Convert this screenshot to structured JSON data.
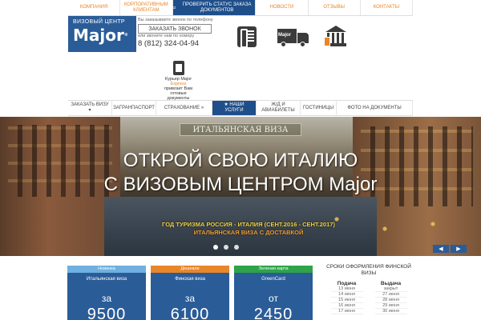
{
  "topnav": {
    "items": [
      {
        "label": "КОМПАНИЯ"
      },
      {
        "label": "КОРПОРАТИВНЫМ КЛИЕНТАМ"
      },
      {
        "label": "ПРОВЕРИТЬ СТАТУС ЗАКАЗА ДОКУМЕНТОВ",
        "active": true
      },
      {
        "label": "НОВОСТИ"
      },
      {
        "label": "ОТЗЫВЫ"
      },
      {
        "label": "КОНТАКТЫ"
      }
    ]
  },
  "header": {
    "logo_top": "ВИЗОВЫЙ ЦЕНТР",
    "logo_brand": "Major",
    "logo_mark": "®",
    "callback_note1": "Вы заказываете звонок по телефону",
    "callback_button": "ЗАКАЗАТЬ ЗВОНОК",
    "callback_note2": "или звоните нам по номеру",
    "phone": "8 (812) 324-04-94",
    "truck_text": "Major",
    "courier_line1": "Курьер Major",
    "courier_line2": "Express",
    "courier_line3": "привозит Вам готовые документы"
  },
  "subnav": {
    "items": [
      {
        "label": "ЗАКАЗАТЬ ВИЗУ ▾"
      },
      {
        "label": "ЗАГРАНПАСПОРТ"
      },
      {
        "label": "СТРАХОВАНИЕ »"
      },
      {
        "label": "★ НАШИ УСЛУГИ",
        "active": true
      },
      {
        "label": "Ж/Д И АВИАБИЛЕТЫ"
      },
      {
        "label": "ГОСТИНИЦЫ"
      },
      {
        "label": "ФОТО НА ДОКУМЕНТЫ"
      }
    ]
  },
  "hero": {
    "badge": "ИТАЛЬЯНСКАЯ ВИЗА",
    "heading_line1": "ОТКРОЙ СВОЮ ИТАЛИЮ",
    "heading_line2": "С ВИЗОВЫМ ЦЕНТРОМ Major",
    "sub_line1": "ГОД ТУРИЗМА РОССИЯ - ИТАЛИЯ (СЕНТ.2016 - СЕНТ.2017)",
    "sub_line2": "ИТАЛЬЯНСКАЯ ВИЗА С ДОСТАВКОЙ",
    "prev": "◀",
    "next": "▶"
  },
  "cards": [
    {
      "tag": "Новинка",
      "title": "Итальянская виза",
      "from": "за",
      "price": "9500",
      "tag_color": "#6fb0e0"
    },
    {
      "tag": "Дешевле",
      "title": "Финская виза",
      "from": "за",
      "price": "6100",
      "tag_color": "#e8862a"
    },
    {
      "tag": "Зеленая карта",
      "title": "GreenCard",
      "from": "от",
      "price": "2450",
      "tag_color": "#2ea34a"
    }
  ],
  "schedule": {
    "title": "СРОКИ ОФОРМЛЕНИЯ ФИНСКОЙ ВИЗЫ",
    "col1_header": "Подача",
    "col2_header": "Выдача",
    "col1": [
      "13 июня",
      "14 июня",
      "15 июня",
      "16 июня",
      "17 июня"
    ],
    "col2": [
      "закрыт",
      "27 июня",
      "28 июня",
      "29 июня",
      "30 июня"
    ]
  },
  "colors": {
    "brand": "#2a5c98",
    "accent": "#e8862a",
    "green": "#2ea34a"
  }
}
